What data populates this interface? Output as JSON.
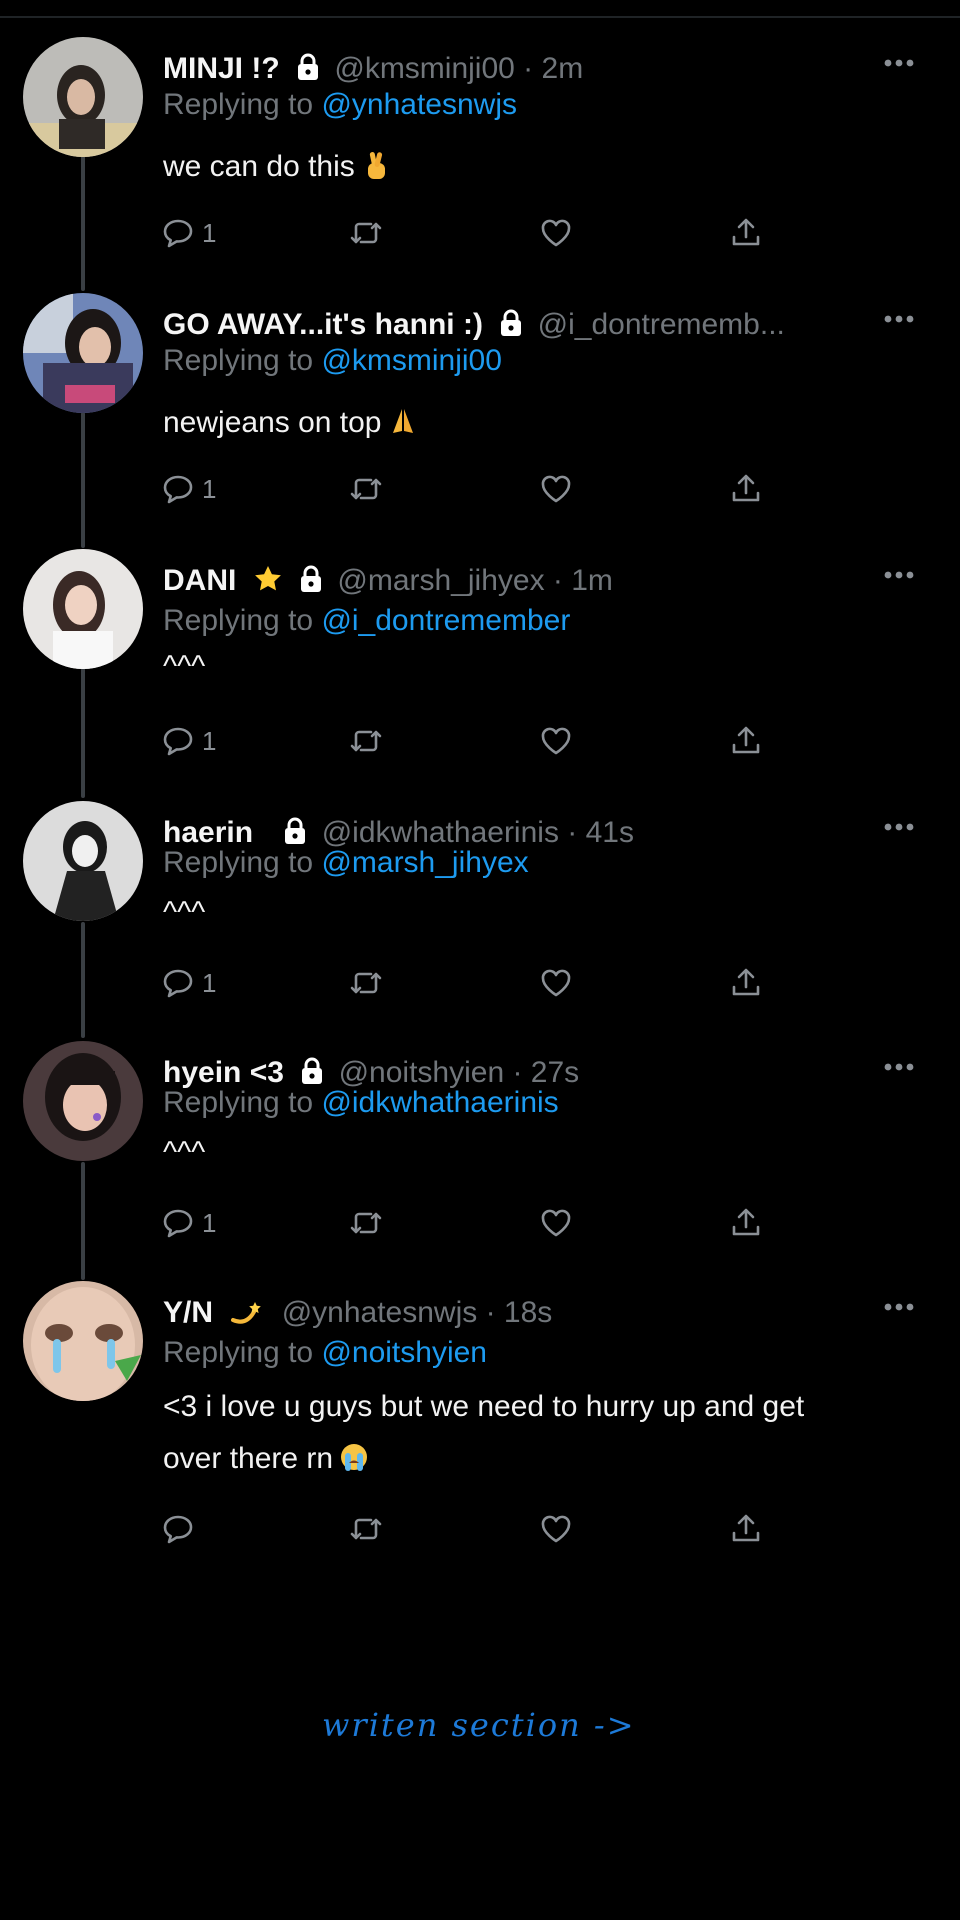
{
  "accent_color": "#1d9bf0",
  "footer": {
    "label": "writen section ->"
  },
  "tweets": [
    {
      "name": "MINJI !?",
      "handle": "@kmsminji00 · 2m",
      "reply_prefix": "Replying to",
      "reply_to": "@ynhatesnwjs",
      "text": "we can do this",
      "emoji": "crossed-fingers",
      "reply_count": "1",
      "has_lock": true,
      "badge": ""
    },
    {
      "name": "GO AWAY...it's hanni :)",
      "handle": "@i_dontrememb...",
      "reply_prefix": "Replying to",
      "reply_to": "@kmsminji00",
      "text": "newjeans on top",
      "emoji": "folded-hands",
      "reply_count": "1",
      "has_lock": true,
      "badge": ""
    },
    {
      "name": "DANI",
      "handle": "@marsh_jihyex · 1m",
      "reply_prefix": "Replying to",
      "reply_to": "@i_dontremember",
      "text": "^^^",
      "emoji": "",
      "reply_count": "1",
      "has_lock": true,
      "badge": "star"
    },
    {
      "name": "haerin",
      "handle": "@idkwhathaerinis · 41s",
      "reply_prefix": "Replying to",
      "reply_to": "@marsh_jihyex",
      "text": "^^^",
      "emoji": "",
      "reply_count": "1",
      "has_lock": true,
      "badge": ""
    },
    {
      "name": "hyein <3",
      "handle": "@noitshyien · 27s",
      "reply_prefix": "Replying to",
      "reply_to": "@idkwhathaerinis",
      "text": "^^^",
      "emoji": "",
      "reply_count": "1",
      "has_lock": true,
      "badge": ""
    },
    {
      "name": "Y/N",
      "handle": "@ynhatesnwjs · 18s",
      "reply_prefix": "Replying to",
      "reply_to": "@noitshyien",
      "text_line1": "<3 i love u guys but we need to hurry up and get",
      "text_line2": "over there rn",
      "emoji": "loudly-crying-face",
      "reply_count": "",
      "has_lock": false,
      "badge": "dizzy"
    }
  ]
}
